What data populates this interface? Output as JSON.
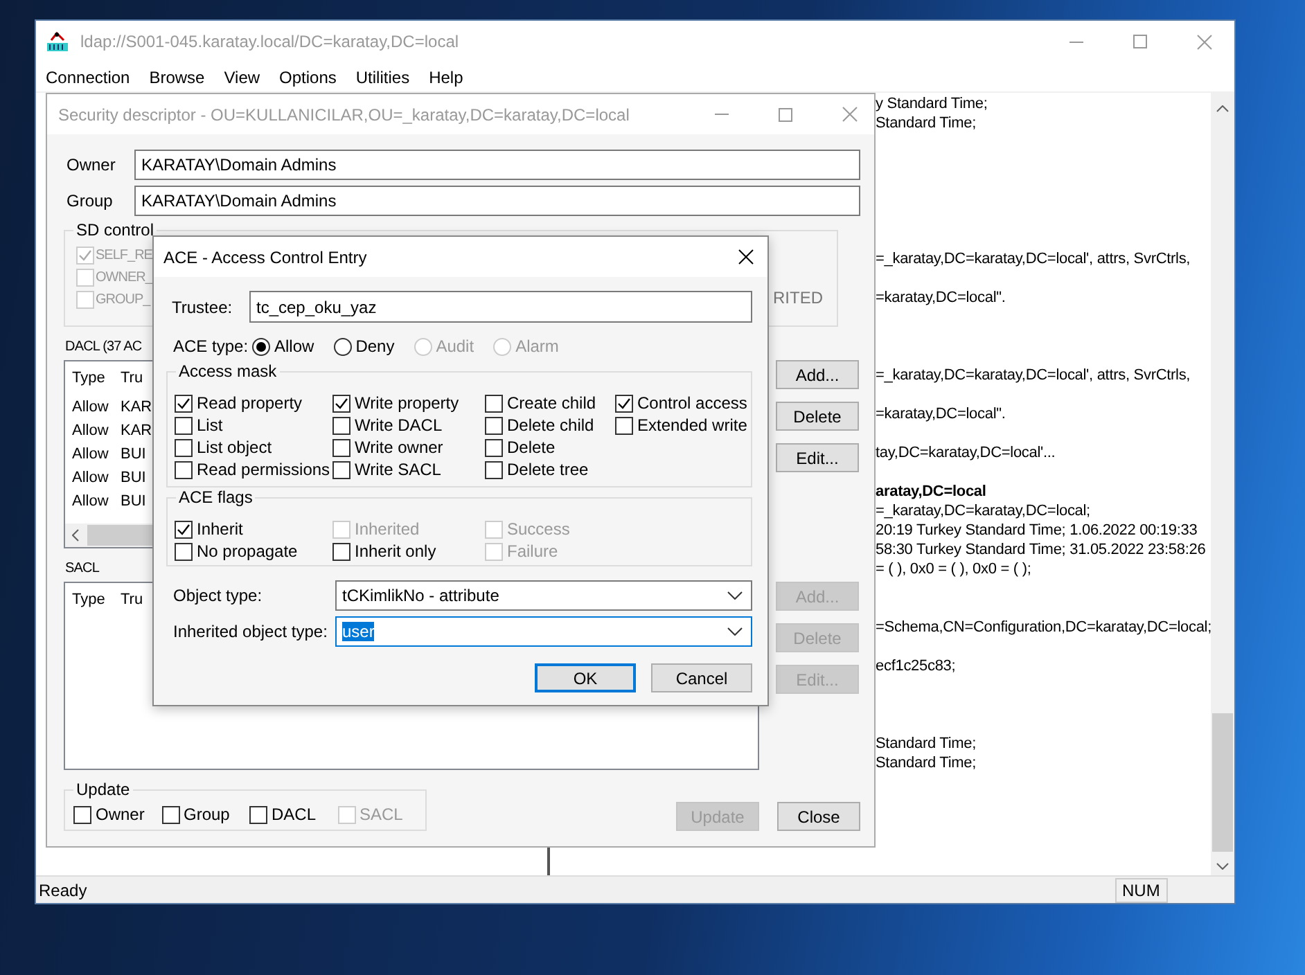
{
  "main_window": {
    "title": "ldap://S001-045.karatay.local/DC=karatay,DC=local",
    "menu": [
      "Connection",
      "Browse",
      "View",
      "Options",
      "Utilities",
      "Help"
    ],
    "log_lines": [
      {
        "text": "y Standard Time;",
        "bold": false
      },
      {
        "text": "Standard Time;",
        "bold": false
      },
      {
        "text": "=_karatay,DC=karatay,DC=local', attrs, SvrCtrls,",
        "bold": false
      },
      {
        "text": "=karatay,DC=local\".",
        "bold": false
      },
      {
        "text": "=_karatay,DC=karatay,DC=local', attrs, SvrCtrls,",
        "bold": false
      },
      {
        "text": "=karatay,DC=local\".",
        "bold": false
      },
      {
        "text": "tay,DC=karatay,DC=local'...",
        "bold": false
      },
      {
        "text": "aratay,DC=local",
        "bold": true
      },
      {
        "text": "=_karatay,DC=karatay,DC=local;",
        "bold": false
      },
      {
        "text": "20:19 Turkey Standard Time; 1.06.2022 00:19:33",
        "bold": false
      },
      {
        "text": "58:30 Turkey Standard Time; 31.05.2022 23:58:26",
        "bold": false
      },
      {
        "text": "= (  ), 0x0 = (  ), 0x0 = (  );",
        "bold": false
      },
      {
        "text": "=Schema,CN=Configuration,DC=karatay,DC=local;",
        "bold": false
      },
      {
        "text": "ecf1c25c83;",
        "bold": false
      },
      {
        "text": "Standard Time;",
        "bold": false
      },
      {
        "text": "Standard Time;",
        "bold": false
      }
    ],
    "status_bar": {
      "text": "Ready",
      "indicator": "NUM"
    }
  },
  "security_descriptor": {
    "title": "Security descriptor - OU=KULLANICILAR,OU=_karatay,DC=karatay,DC=local",
    "fields": [
      {
        "label": "Owner",
        "value": "KARATAY\\Domain Admins"
      },
      {
        "label": "Group",
        "value": "KARATAY\\Domain Admins"
      }
    ],
    "sd_control": {
      "title": "SD control",
      "items": [
        {
          "label": "SELF_RE",
          "checked": true,
          "disabled": true
        },
        {
          "label": "OWNER_",
          "checked": false,
          "disabled": true
        },
        {
          "label": "GROUP_",
          "checked": false,
          "disabled": true
        }
      ],
      "note": "RITED"
    },
    "dacl": {
      "title": "DACL (37 AC",
      "columns": [
        "Type",
        "Tru"
      ],
      "rows": [
        [
          "Allow",
          "KAR"
        ],
        [
          "Allow",
          "KAR"
        ],
        [
          "Allow",
          "BUI"
        ],
        [
          "Allow",
          "BUI"
        ],
        [
          "Allow",
          "BUI"
        ]
      ],
      "buttons": [
        {
          "label": "Add...",
          "disabled": false
        },
        {
          "label": "Delete",
          "disabled": false
        },
        {
          "label": "Edit...",
          "disabled": false
        }
      ]
    },
    "sacl": {
      "title": "SACL",
      "columns": [
        "Type",
        "Tru"
      ],
      "buttons": [
        {
          "label": "Add...",
          "disabled": true
        },
        {
          "label": "Delete",
          "disabled": true
        },
        {
          "label": "Edit...",
          "disabled": true
        }
      ]
    },
    "update": {
      "title": "Update",
      "items": [
        {
          "label": "Owner",
          "checked": false,
          "disabled": false
        },
        {
          "label": "Group",
          "checked": false,
          "disabled": false
        },
        {
          "label": "DACL",
          "checked": false,
          "disabled": false
        },
        {
          "label": "SACL",
          "checked": false,
          "disabled": true
        }
      ]
    },
    "buttons": [
      {
        "label": "Update",
        "disabled": true
      },
      {
        "label": "Close",
        "disabled": false
      }
    ]
  },
  "ace_dialog": {
    "title": "ACE - Access Control Entry",
    "trustee": {
      "label": "Trustee:",
      "value": "tc_cep_oku_yaz"
    },
    "ace_type": {
      "label": "ACE type:",
      "options": [
        {
          "label": "Allow",
          "selected": true,
          "disabled": false
        },
        {
          "label": "Deny",
          "selected": false,
          "disabled": false
        },
        {
          "label": "Audit",
          "selected": false,
          "disabled": true
        },
        {
          "label": "Alarm",
          "selected": false,
          "disabled": true
        }
      ]
    },
    "access_mask": {
      "title": "Access mask",
      "columns": [
        {
          "items": [
            {
              "label": "Read property",
              "checked": true,
              "disabled": false
            },
            {
              "label": "List",
              "checked": false,
              "disabled": false
            },
            {
              "label": "List object",
              "checked": false,
              "disabled": false
            },
            {
              "label": "Read permissions",
              "checked": false,
              "disabled": false
            }
          ]
        },
        {
          "items": [
            {
              "label": "Write property",
              "checked": true,
              "disabled": false
            },
            {
              "label": "Write DACL",
              "checked": false,
              "disabled": false
            },
            {
              "label": "Write owner",
              "checked": false,
              "disabled": false
            },
            {
              "label": "Write SACL",
              "checked": false,
              "disabled": false
            }
          ]
        },
        {
          "items": [
            {
              "label": "Create child",
              "checked": false,
              "disabled": false
            },
            {
              "label": "Delete child",
              "checked": false,
              "disabled": false
            },
            {
              "label": "Delete",
              "checked": false,
              "disabled": false
            },
            {
              "label": "Delete tree",
              "checked": false,
              "disabled": false
            }
          ]
        },
        {
          "items": [
            {
              "label": "Control access",
              "checked": true,
              "disabled": false
            },
            {
              "label": "Extended write",
              "checked": false,
              "disabled": false
            }
          ]
        }
      ]
    },
    "ace_flags": {
      "title": "ACE flags",
      "columns": [
        {
          "items": [
            {
              "label": "Inherit",
              "checked": true,
              "disabled": false
            },
            {
              "label": "No propagate",
              "checked": false,
              "disabled": false
            }
          ]
        },
        {
          "items": [
            {
              "label": "Inherited",
              "checked": false,
              "disabled": true
            },
            {
              "label": "Inherit only",
              "checked": false,
              "disabled": false
            }
          ]
        },
        {
          "items": [
            {
              "label": "Success",
              "checked": false,
              "disabled": true
            },
            {
              "label": "Failure",
              "checked": false,
              "disabled": true
            }
          ]
        }
      ]
    },
    "dropdowns": [
      {
        "label": "Object type:",
        "value": "tCKimlikNo - attribute",
        "focused": false
      },
      {
        "label": "Inherited object type:",
        "value": "user",
        "focused": true
      }
    ],
    "buttons": [
      {
        "label": "OK",
        "default": true
      },
      {
        "label": "Cancel",
        "default": false
      }
    ]
  }
}
